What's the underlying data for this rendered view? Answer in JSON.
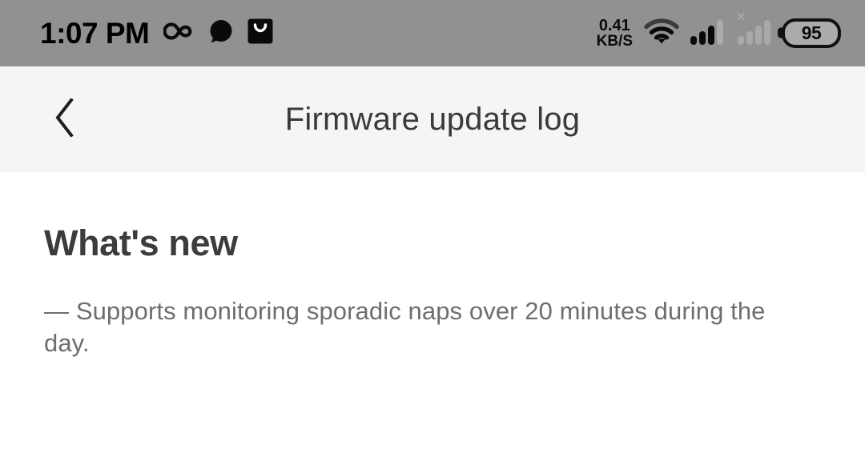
{
  "status_bar": {
    "time": "1:07 PM",
    "notification_icons": [
      "infinity-icon",
      "chat-bubble-icon",
      "shopping-bag-icon"
    ],
    "network_speed_value": "0.41",
    "network_speed_unit": "KB/S",
    "wifi_icon": "wifi-icon",
    "signal_primary_icon": "cellular-signal-icon",
    "signal_secondary_icon": "cellular-signal-no-sim-icon",
    "no_sim_marker": "×",
    "battery_level": "95",
    "background_color": "#919191"
  },
  "nav_bar": {
    "back_icon": "chevron-left-icon",
    "title": "Firmware update log",
    "background_color": "#f5f5f5"
  },
  "content": {
    "section_title": "What's new",
    "changelog": [
      "— Supports monitoring sporadic naps over 20 minutes during the day."
    ],
    "background_color": "#ffffff",
    "title_color": "#3c3c3c",
    "body_color": "#6e6e6e"
  }
}
